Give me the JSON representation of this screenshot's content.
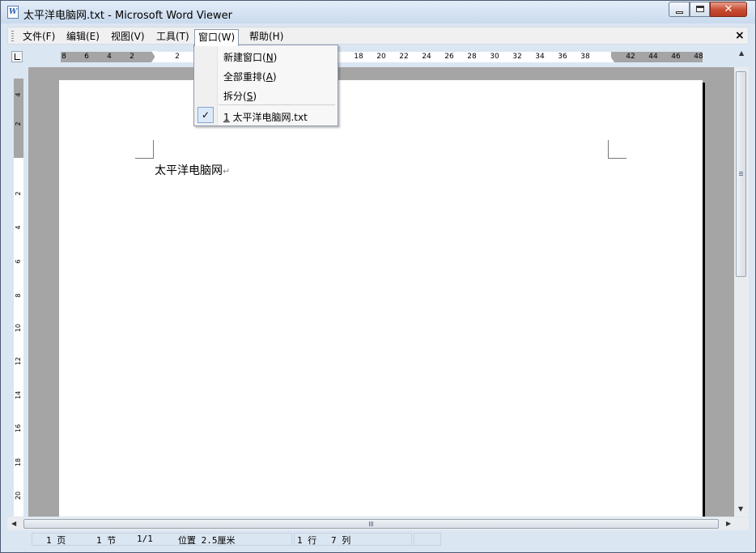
{
  "window": {
    "title": "太平洋电脑网.txt - Microsoft Word Viewer",
    "icon": "word-viewer-icon",
    "close_glyph": "✕"
  },
  "menubar": {
    "items": [
      "文件(F)",
      "编辑(E)",
      "视图(V)",
      "工具(T)",
      "窗口(W)",
      "帮助(H)"
    ],
    "open_item": "窗口(W)",
    "close_glyph": "×"
  },
  "window_menu": {
    "items": [
      {
        "prefix": "新建窗口(",
        "key": "N",
        "suffix": ")"
      },
      {
        "prefix": "全部重排(",
        "key": "A",
        "suffix": ")"
      },
      {
        "prefix": "拆分(",
        "key": "S",
        "suffix": ")"
      }
    ],
    "recent": {
      "key": "1",
      "label": " 太平洋电脑网.txt",
      "checked": true,
      "check_glyph": "✓"
    }
  },
  "ruler": {
    "left_numbers": [
      "8",
      "6",
      "4",
      "2"
    ],
    "right_numbers": [
      "2",
      "18",
      "20",
      "22",
      "24",
      "26",
      "28",
      "30",
      "32",
      "34",
      "36",
      "38",
      "42",
      "44",
      "46",
      "48"
    ],
    "vertical_numbers": [
      "4",
      "2",
      "2",
      "4",
      "6",
      "8",
      "10",
      "12",
      "14",
      "16",
      "18",
      "20"
    ]
  },
  "document": {
    "text": "太平洋电脑网",
    "paragraph_mark": "↵"
  },
  "status": {
    "page": "1 页",
    "section": "1 节",
    "page_of": "1/1",
    "position": "位置 2.5厘米",
    "line": "1 行",
    "column": "7 列"
  },
  "scrollbar": {
    "up_glyph": "▲",
    "down_glyph": "▼",
    "left_glyph": "◀",
    "right_glyph": "▶"
  }
}
